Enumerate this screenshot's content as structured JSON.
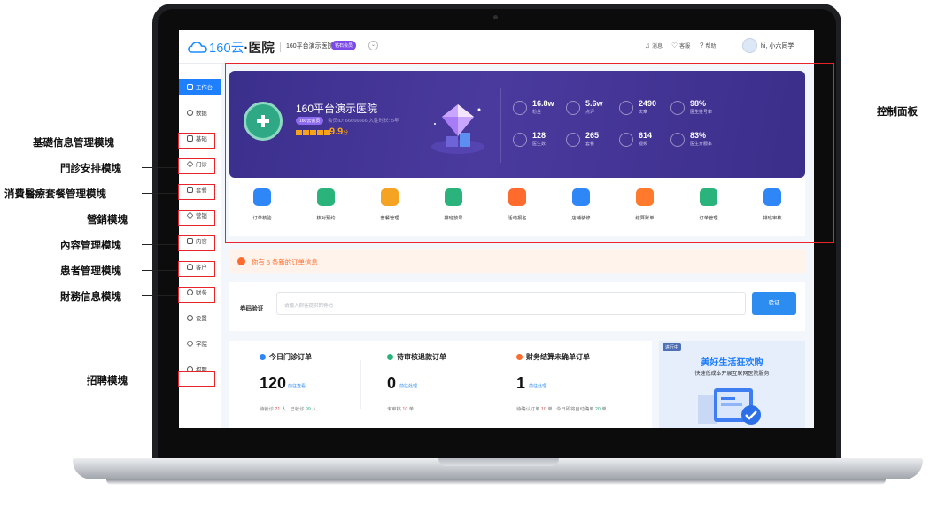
{
  "topbar": {
    "brand_prefix": "160云",
    "brand_suffix": "·医院",
    "hospital_name": "160平台演示医院",
    "vip_badge": "钻石会员",
    "right_items": [
      "消息",
      "客服",
      "帮助"
    ],
    "user": "hi, 小六同学"
  },
  "sidebar": {
    "items": [
      {
        "label": "工作台",
        "icon": "workbench-icon",
        "active": true
      },
      {
        "label": "数据",
        "icon": "clock-icon"
      },
      {
        "label": "基础",
        "icon": "layers-icon"
      },
      {
        "label": "门诊",
        "icon": "diamond-icon"
      },
      {
        "label": "套餐",
        "icon": "package-icon"
      },
      {
        "label": "营销",
        "icon": "tag-icon"
      },
      {
        "label": "内容",
        "icon": "document-icon"
      },
      {
        "label": "客户",
        "icon": "person-icon"
      },
      {
        "label": "财务",
        "icon": "coin-icon"
      },
      {
        "label": "设置",
        "icon": "gear-icon"
      },
      {
        "label": "学院",
        "icon": "graduation-icon"
      },
      {
        "label": "招聘",
        "icon": "recruit-icon"
      }
    ]
  },
  "banner": {
    "hospital": "160平台演示医院",
    "tag": "160云会员",
    "member_info": "会员ID: 66666666  入驻时长: 5年",
    "score": "9.9",
    "score_unit": "分",
    "stats": [
      {
        "value": "16.8w",
        "label": "粉丝"
      },
      {
        "value": "5.6w",
        "label": "点评"
      },
      {
        "value": "2490",
        "label": "文章"
      },
      {
        "value": "98%",
        "label": "医生挂号率"
      },
      {
        "value": "128",
        "label": "医生数"
      },
      {
        "value": "265",
        "label": "套餐"
      },
      {
        "value": "614",
        "label": "视频"
      },
      {
        "value": "83%",
        "label": "医生开服率"
      }
    ]
  },
  "shortcuts": [
    {
      "label": "订单核验",
      "color": "#2f86f6"
    },
    {
      "label": "核对预约",
      "color": "#2ab37a"
    },
    {
      "label": "套餐管理",
      "color": "#f4a323"
    },
    {
      "label": "排班放号",
      "color": "#2ab37a"
    },
    {
      "label": "活动报名",
      "color": "#ff6b2c"
    },
    {
      "label": "店铺装修",
      "color": "#2f86f6"
    },
    {
      "label": "结算账单",
      "color": "#ff7a2c"
    },
    {
      "label": "订单管理",
      "color": "#2ab37a"
    },
    {
      "label": "排班审核",
      "color": "#2f86f6"
    }
  ],
  "notice": {
    "text": "你有 5 条新的订单信息"
  },
  "coupon": {
    "label": "券码验证",
    "placeholder": "请输入顾客提供的券码",
    "button": "验证"
  },
  "orders": [
    {
      "title": "今日门诊订单",
      "dot": "#2f86f6",
      "value": "120",
      "link": "前往查看",
      "sub_a": "待就诊",
      "val_a": "21",
      "unit_a": "人",
      "sub_b": "已就诊",
      "val_b": "99",
      "unit_b": "人"
    },
    {
      "title": "待审核退款订单",
      "dot": "#2ab37a",
      "value": "0",
      "link": "前往处理",
      "sub_a": "未审核",
      "val_a": "10",
      "unit_a": "单",
      "sub_b": "",
      "val_b": "",
      "unit_b": ""
    },
    {
      "title": "财务结算未确单订单",
      "dot": "#ff6b2c",
      "value": "1",
      "link": "前往处理",
      "sub_a": "待确认订单",
      "val_a": "10",
      "unit_a": "单",
      "sub_b": "今日即将自动确单",
      "val_b": "20",
      "unit_b": "单"
    }
  ],
  "promo": {
    "tag": "进行中",
    "title": "美好生活狂欢购",
    "subtitle": "快速低成本开展互联网医院服务"
  },
  "annotations": {
    "left": [
      "基礎信息管理模塊",
      "門診安排模塊",
      "消費醫療套餐管理模塊",
      "營銷模塊",
      "內容管理模塊",
      "患者管理模塊",
      "財務信息模塊",
      "招聘模塊"
    ],
    "right": "控制面板"
  },
  "colors": {
    "accent": "#1e80ff",
    "banner": "#3f3291",
    "annotation": "#e8232a"
  }
}
